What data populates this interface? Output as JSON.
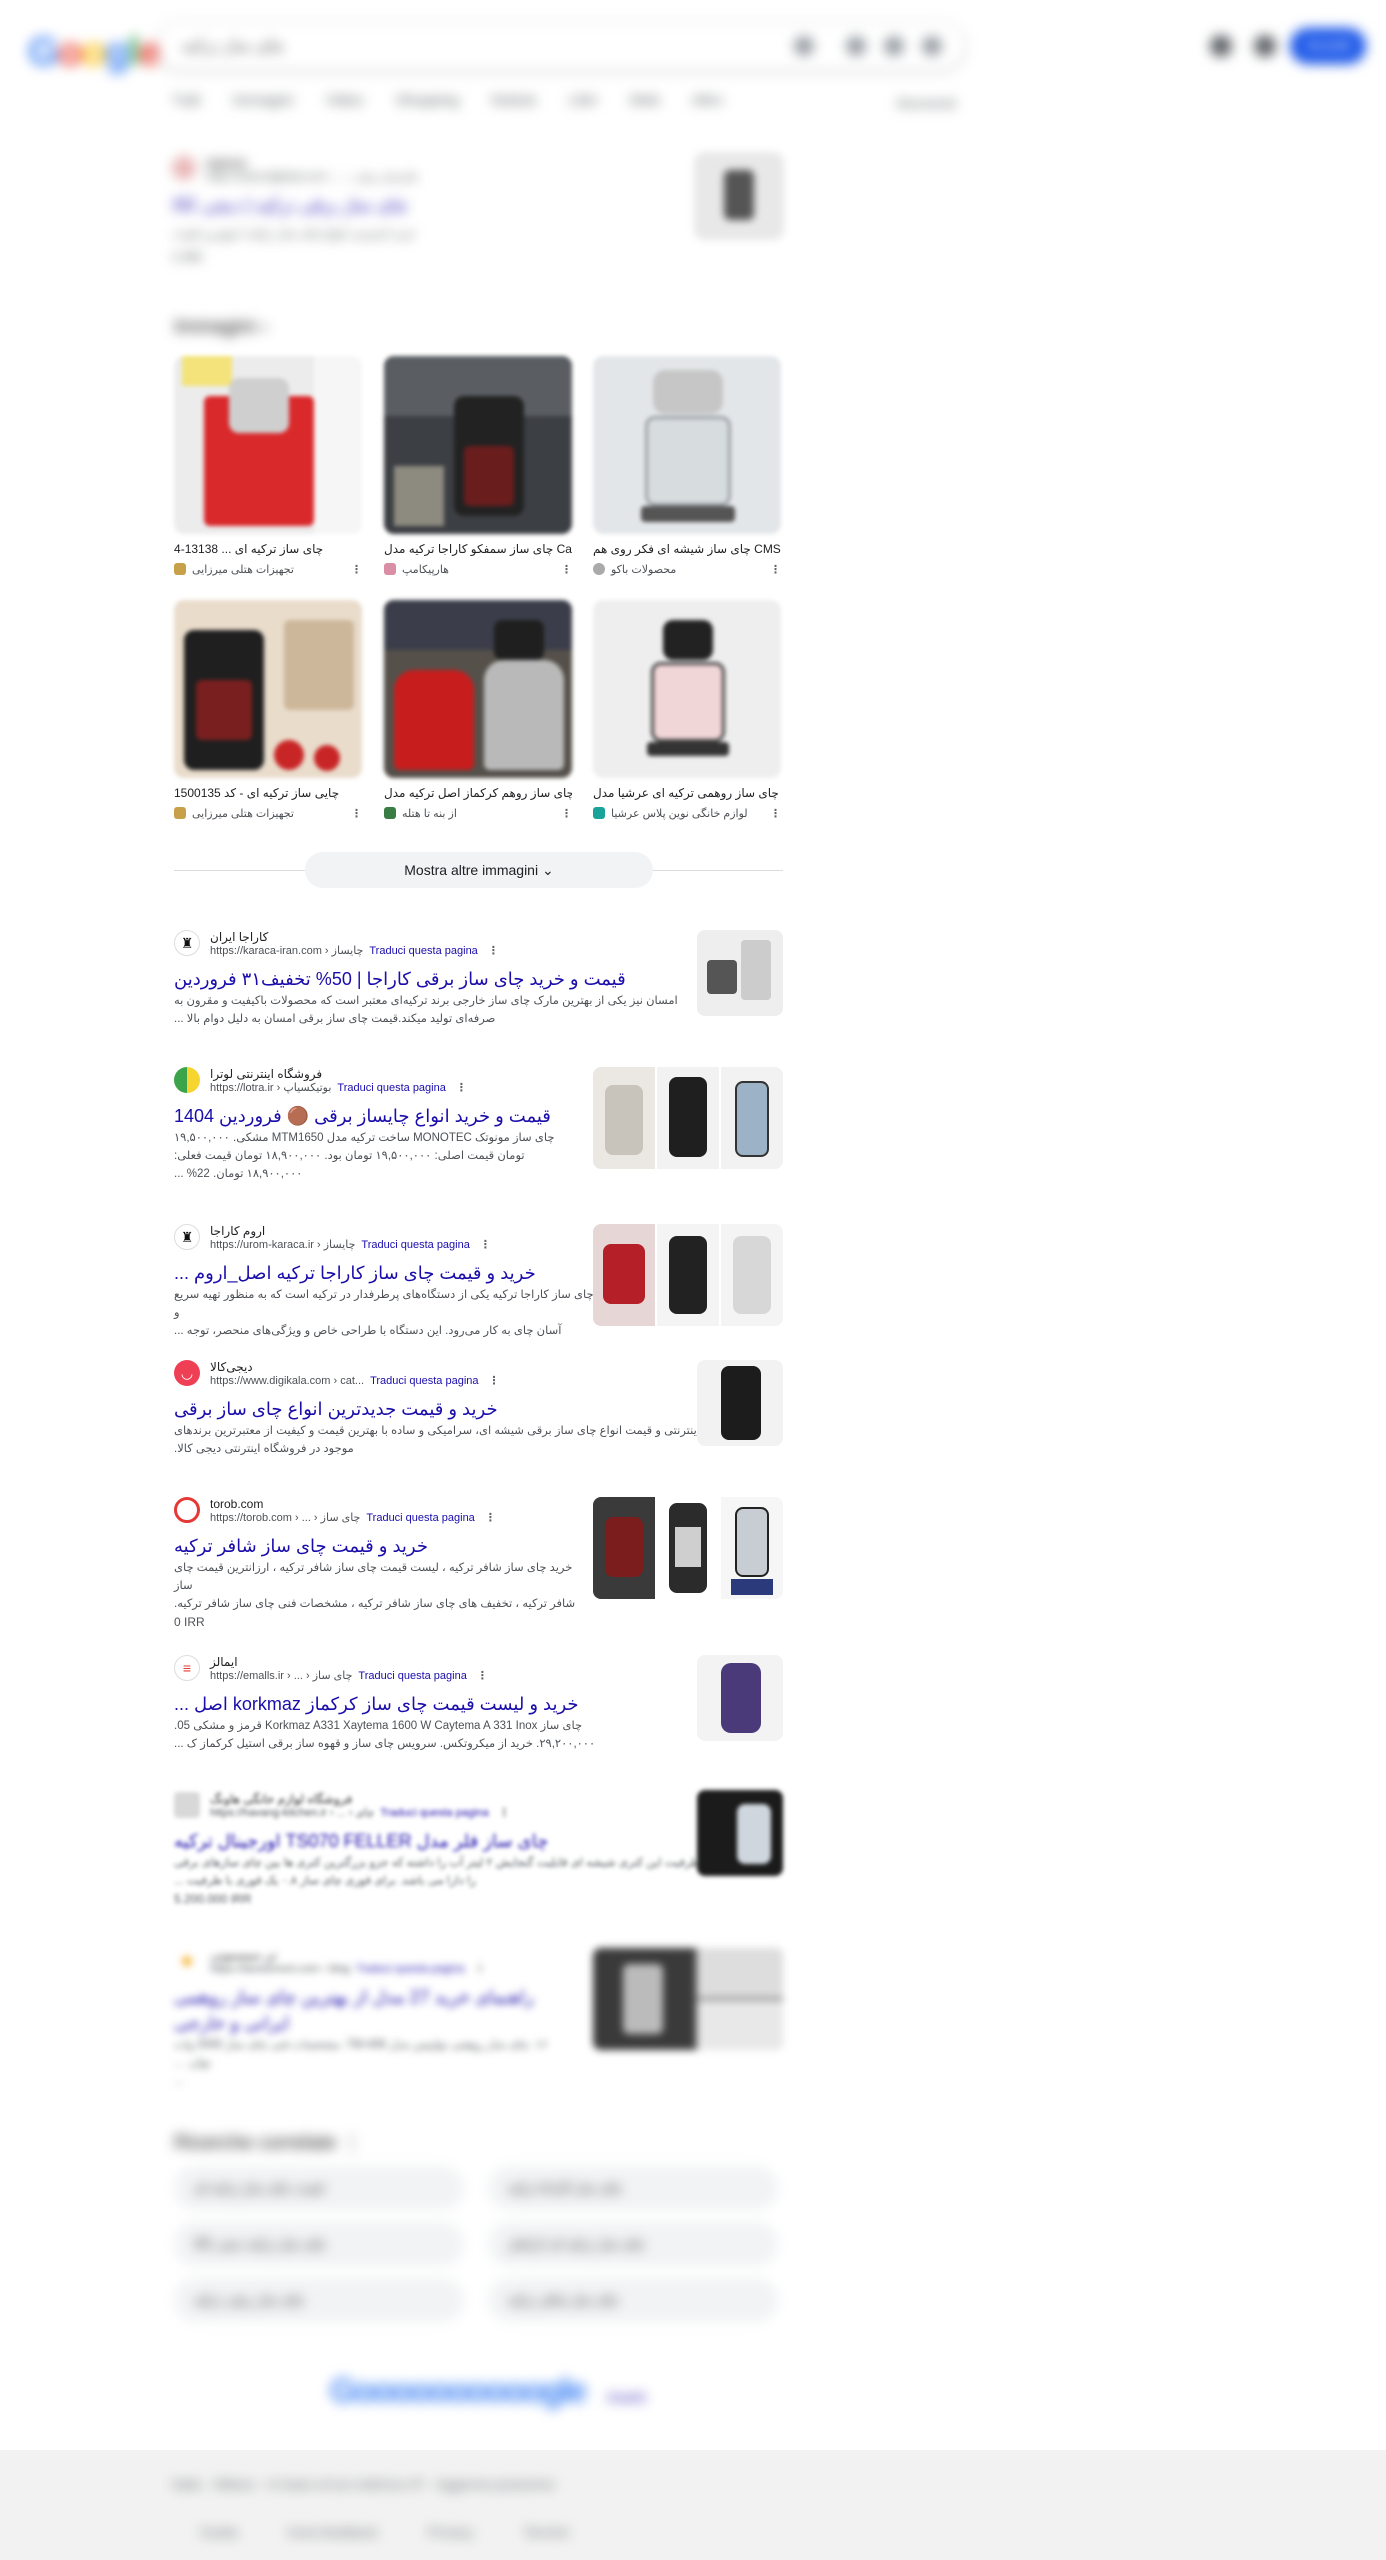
{
  "header": {
    "logo": "Google",
    "query": "چای ساز ترکیه",
    "tabs": [
      "Tutti",
      "Immagini",
      "Video",
      "Shopping",
      "Notizie",
      "Libri",
      "Web",
      "Altro"
    ],
    "tools": "Strumenti",
    "signin": "Accedi"
  },
  "top_result": {
    "site": "digikala",
    "url": "https://www.digikala.com › ... › چای‌ساز برقی",
    "title": "چای ساز برقی ترکیه | دیجی کالا",
    "snippet": "خرید اینترنتی انواع چای ساز ترکیه با بهترین قیمت",
    "extra": "2.490"
  },
  "images": {
    "heading": "Immagini",
    "items": [
      {
        "caption": "چای ساز ترکیه ای ... 13138-4",
        "source": "تجهیزات هتلی میرزایی"
      },
      {
        "caption": "چای ساز سمفکو کاراجا ترکیه مدل Ca...",
        "source": "هارپیکامپ"
      },
      {
        "caption": "چای ساز شیشه ای فکر روی هم CMS...",
        "source": "محصولات باکو"
      },
      {
        "caption": "چایی ساز ترکیه ای - کد 1500135",
        "source": "تجهیزات هتلی میرزایی"
      },
      {
        "caption": "چای ساز روهم کرکماز اصل ترکیه مدل ...",
        "source": "از بنه تا هتله"
      },
      {
        "caption": "چای ساز روهمی ترکیه ای عرشیا مدل ...",
        "source": "لوازم خانگی نوین پلاس عرشیا"
      }
    ],
    "more_button": "Mostra altre immagini"
  },
  "results": [
    {
      "site": "کاراجا ایران",
      "url": "https://karaca-iran.com › چایساز",
      "translate": "Traduci questa pagina",
      "title": "قیمت و خرید چای ساز برقی کاراجا | 50% تخفیف۳۱ فروردین",
      "snippet_1": "امسان نیز یکی از بهترین مارک چای ساز خارجی برند ترکیه‌ای معتبر است که محصولات باکیفیت و مقرون به",
      "snippet_2": "صرفه‌ای تولید میکند.قیمت چای ساز برقی امسان به دلیل دوام بالا ...",
      "price": ""
    },
    {
      "site": "فروشگاه اینترنتی لوترا",
      "url": "https://lotra.ir › بوتیکسیاپ",
      "translate": "Traduci questa pagina",
      "title": "قیمت و خرید انواع چایساز برقی 🟤 فروردین 1404",
      "snippet_1": "چای ساز مونوتک MONOTEC ساخت ترکیه مدل MTM1650 مشکی. ۱۹,۵۰۰,۰۰۰",
      "snippet_2": "تومان قیمت اصلی: ۱۹,۵۰۰,۰۰۰ تومان بود. ۱۸,۹۰۰,۰۰۰ تومان قیمت فعلی:",
      "price": "۱۸,۹۰۰,۰۰۰ تومان. 22% ..."
    },
    {
      "site": "اروم کاراجا",
      "url": "https://urom-karaca.ir › چایساز",
      "translate": "Traduci questa pagina",
      "title": "خرید و قیمت چای ساز کاراجا ترکیه اصل_اروم ...",
      "snippet_1": "چای ساز کاراجا ترکیه یکی از دستگاه‌های پرطرفدار در ترکیه است که به منظور تهیه سریع و",
      "snippet_2": "آسان چای به کار می‌رود. این دستگاه با طراحی خاص و ویژگی‌های منحصر، توجه ...",
      "price": ""
    },
    {
      "site": "دیجی‌کالا",
      "url": "https://www.digikala.com › cat...",
      "translate": "Traduci questa pagina",
      "title": "خرید و قیمت جدیدترین انواع چای ساز برقی",
      "snippet_1": "خرید اینترنتی و قیمت انواع چای ساز برقی شیشه ای، سرامیکی و ساده با بهترین قیمت و کیفیت از معتبرترین برندهای",
      "snippet_2": "موجود در فروشگاه اینترنتی دیجی کالا.",
      "price": ""
    },
    {
      "site": "torob.com",
      "url": "https://torob.com › ... › چای ساز",
      "translate": "Traduci questa pagina",
      "title": "خرید و قیمت چای ساز شافر ترکیه",
      "snippet_1": "خرید چای ساز شافر ترکیه ، لیست قیمت چای ساز شافر ترکیه ، ارزانترین قیمت چای ساز",
      "snippet_2": "شافر ترکیه ، تخفیف های چای ساز شافر ترکیه ، مشخصات فنی چای ساز شافر ترکیه.",
      "price": "0 IRR"
    },
    {
      "site": "ایمالز",
      "url": "https://emalls.ir › ... › چای ساز",
      "translate": "Traduci questa pagina",
      "title": "خرید و لیست قیمت چای ساز کرکماز korkmaz اصل ...",
      "snippet_1": "چای ساز Korkmaz A331 Xaytema 1600 W Caytema A 331 Inox قرمز و مشکی 05.",
      "snippet_2": "۲۹,۲۰۰,۰۰۰. خرید از میکروتکس. سرویس چای ساز و قهوه ساز برقی استیل کرکماز ک ...",
      "price": ""
    },
    {
      "site": "فروشگاه لوازم خانگی هاونگ",
      "url": "https://havang-kitchen.ir › ... › چای",
      "translate": "Traduci questa pagina",
      "title": "چای ساز فلر مدل TS070 FELLER اورجینال ترکیه",
      "snippet_1": "ظرفیت این کتری شیشه ای قابلیت گنجایش ۲ لیتر آب را داشته که جزو بزرگترین کتری ها بین چای سازهای برقی",
      "snippet_2": "را دارا می باشد. برای قوری چای ساز ۰.۸ یک قوری با ظرفیت ...",
      "price": "5.200.000 IRR"
    },
    {
      "site": "تن سیسمونی",
      "url": "https://tansismoni.com › blog",
      "translate": "Traduci questa pagina",
      "title": "راهنمای خرید 27 مدل از بهترین چای ساز روهمی ایرانی و خارجی",
      "snippet_1": "۱۶. چای ساز روهمی تولیپس مدل TM-406. مشخصات فنی چای ساز 2000 وات توان. ...",
      "snippet_2": "...",
      "price": ""
    }
  ],
  "related": {
    "heading": "Ricerche correlate",
    "items": [
      "قیمت چای ساز ترکیه ای",
      "چای ساز کاراجا ترکیه",
      "چای ساز ترکیه دیجی کالا",
      "چای ساز ترکیه ای کرکماز",
      "چای ساز برقی ترکیه",
      "چای ساز شافر ترکیه"
    ]
  },
  "pager": {
    "logo": "Goooooooooogle",
    "next": "Avanti"
  },
  "footer": {
    "location": "Italia · Milano · In base al tuo indirizzo IP · Aggiorna posizione",
    "links": [
      "Guida",
      "Invia feedback",
      "Privacy",
      "Termini"
    ]
  },
  "colors": {
    "link": "#1a0dab",
    "accent": "#1a56e8",
    "chip_bg": "#f1f3f4"
  }
}
